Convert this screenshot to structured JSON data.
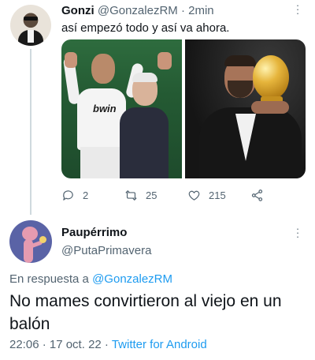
{
  "parent_tweet": {
    "display_name": "Gonzi",
    "handle": "@GonzalezRM",
    "separator": " · ",
    "time_ago": "2min",
    "text": "así empezó todo y así va ahora.",
    "more_icon": "more-vertical-icon",
    "media": [
      {
        "alt_icon": "photo-benzema-young"
      },
      {
        "alt_icon": "photo-benzema-ballon-dor"
      }
    ],
    "actions": {
      "reply_count": "2",
      "retweet_count": "25",
      "like_count": "215"
    }
  },
  "reply_tweet": {
    "display_name": "Paupérrimo",
    "handle": "@PutaPrimavera",
    "replying_prefix": "En respuesta a ",
    "replying_to": "@GonzalezRM",
    "text": "No mames convirtieron al viejo en un balón",
    "timestamp": "22:06 · 17 oct. 22 · ",
    "source": "Twitter for Android"
  },
  "colors": {
    "text_primary": "#0f1419",
    "text_secondary": "#536471",
    "link": "#1d9bf0",
    "thread_line": "#cfd9de"
  }
}
